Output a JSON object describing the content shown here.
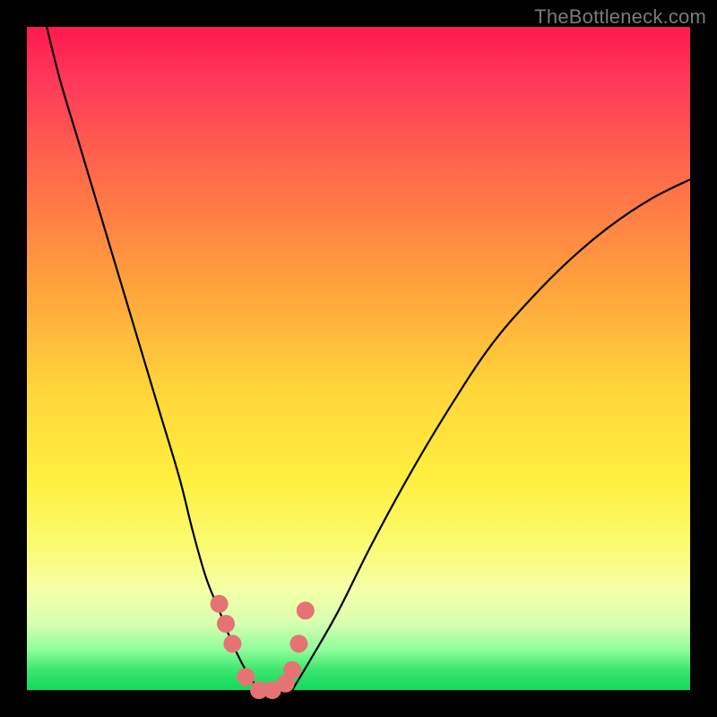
{
  "watermark": "TheBottleneck.com",
  "colors": {
    "background": "#000000",
    "curve": "#000000",
    "markers": "#e57373",
    "gradient_top": "#ff1a4d",
    "gradient_bottom": "#12d85c"
  },
  "chart_data": {
    "type": "line",
    "title": "",
    "xlabel": "",
    "ylabel": "",
    "xlim": [
      0,
      100
    ],
    "ylim": [
      0,
      100
    ],
    "series": [
      {
        "name": "left-branch",
        "x": [
          3,
          5,
          8,
          11,
          14,
          17,
          20,
          23,
          25,
          27,
          29,
          31,
          33,
          35
        ],
        "y": [
          100,
          92,
          82,
          72,
          62,
          52,
          42,
          32,
          24,
          17,
          12,
          7,
          3,
          0
        ]
      },
      {
        "name": "right-branch",
        "x": [
          40,
          43,
          47,
          52,
          58,
          64,
          70,
          76,
          82,
          88,
          94,
          100
        ],
        "y": [
          0,
          5,
          12,
          22,
          33,
          43,
          52,
          59,
          65,
          70,
          74,
          77
        ]
      },
      {
        "name": "markers",
        "style": "scatter",
        "x": [
          29,
          30,
          31,
          33,
          35,
          37,
          39,
          40,
          41,
          42
        ],
        "y": [
          13,
          10,
          7,
          2,
          0,
          0,
          1,
          3,
          7,
          12
        ]
      }
    ]
  }
}
